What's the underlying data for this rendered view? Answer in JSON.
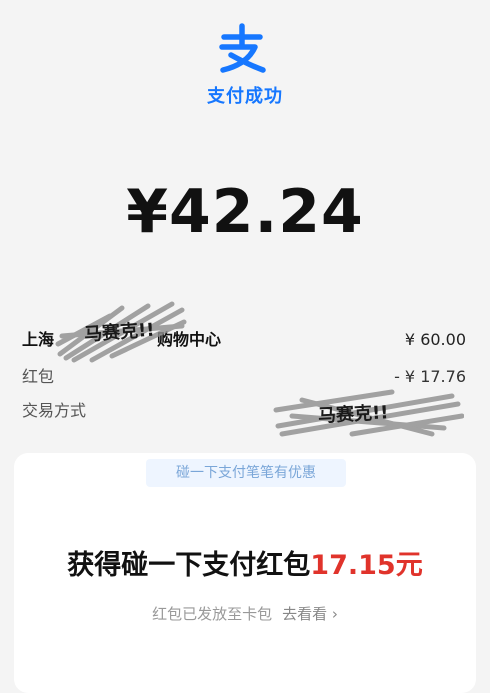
{
  "header": {
    "logo_icon": "alipay-logo-icon",
    "status_text": "支付成功"
  },
  "payment": {
    "amount": "¥42.24"
  },
  "details": {
    "merchant": {
      "label_left": "上海",
      "label_right": "购物中心",
      "value": "¥ 60.00"
    },
    "red_packet": {
      "label": "红包",
      "value": "- ¥ 17.76"
    },
    "payment_method": {
      "label": "交易方式"
    }
  },
  "overlay": {
    "scribble_text": "马赛克!!"
  },
  "promo": {
    "banner_text": "碰一下支付笔笔有优惠",
    "headline_prefix": "获得碰一下支付红包",
    "headline_amount": "17.15元",
    "subtext": "红包已发放至卡包",
    "link_text": "去看看 ›"
  },
  "colors": {
    "accent_blue": "#1677ff",
    "amount_red": "#e0332b",
    "background": "#f4f4f4"
  }
}
